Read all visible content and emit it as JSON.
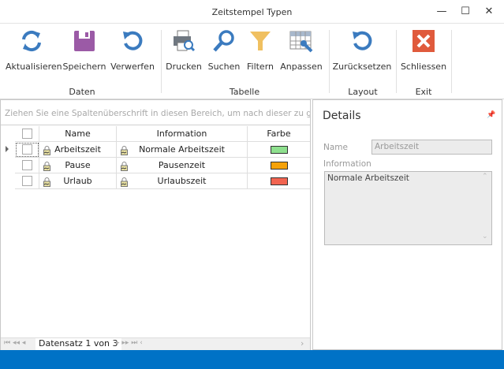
{
  "window": {
    "title": "Zeitstempel Typen",
    "controls": {
      "minimize": "—",
      "maximize": "☐",
      "close": "✕"
    }
  },
  "ribbon": {
    "groups": [
      {
        "label": "Daten",
        "buttons": [
          {
            "label": "Aktualisieren",
            "icon": "refresh-icon"
          },
          {
            "label": "Speichern",
            "icon": "save-icon"
          },
          {
            "label": "Verwerfen",
            "icon": "undo-icon"
          }
        ]
      },
      {
        "label": "Tabelle",
        "buttons": [
          {
            "label": "Drucken",
            "icon": "print-preview-icon"
          },
          {
            "label": "Suchen",
            "icon": "search-icon"
          },
          {
            "label": "Filtern",
            "icon": "filter-icon"
          },
          {
            "label": "Anpassen",
            "icon": "customize-grid-icon"
          }
        ]
      },
      {
        "label": "Layout",
        "buttons": [
          {
            "label": "Zurücksetzen",
            "icon": "reset-icon"
          }
        ]
      },
      {
        "label": "Exit",
        "buttons": [
          {
            "label": "Schliessen",
            "icon": "close-icon"
          }
        ]
      }
    ]
  },
  "grid": {
    "group_panel_text": "Ziehen Sie eine Spaltenüberschrift in diesen Bereich, um nach dieser zu gruppier",
    "columns": [
      "Name",
      "Information",
      "Farbe"
    ],
    "rows": [
      {
        "name": "Arbeitszeit",
        "information": "Normale Arbeitszeit",
        "color": "#8ee08e",
        "selected": true
      },
      {
        "name": "Pause",
        "information": "Pausenzeit",
        "color": "#f5a20a",
        "selected": false
      },
      {
        "name": "Urlaub",
        "information": "Urlaubszeit",
        "color": "#f26450",
        "selected": false
      }
    ],
    "navigator": {
      "text": "Datensatz 1 von 3"
    }
  },
  "details": {
    "title": "Details",
    "name_label": "Name",
    "name_value": "Arbeitszeit",
    "information_label": "Information",
    "information_value": "Normale Arbeitszeit"
  },
  "colors": {
    "accent": "#0072c6",
    "refresh": "#3b7bbf",
    "save": "#9b5aa6",
    "close": "#e05a3c",
    "filter": "#f0c060"
  }
}
